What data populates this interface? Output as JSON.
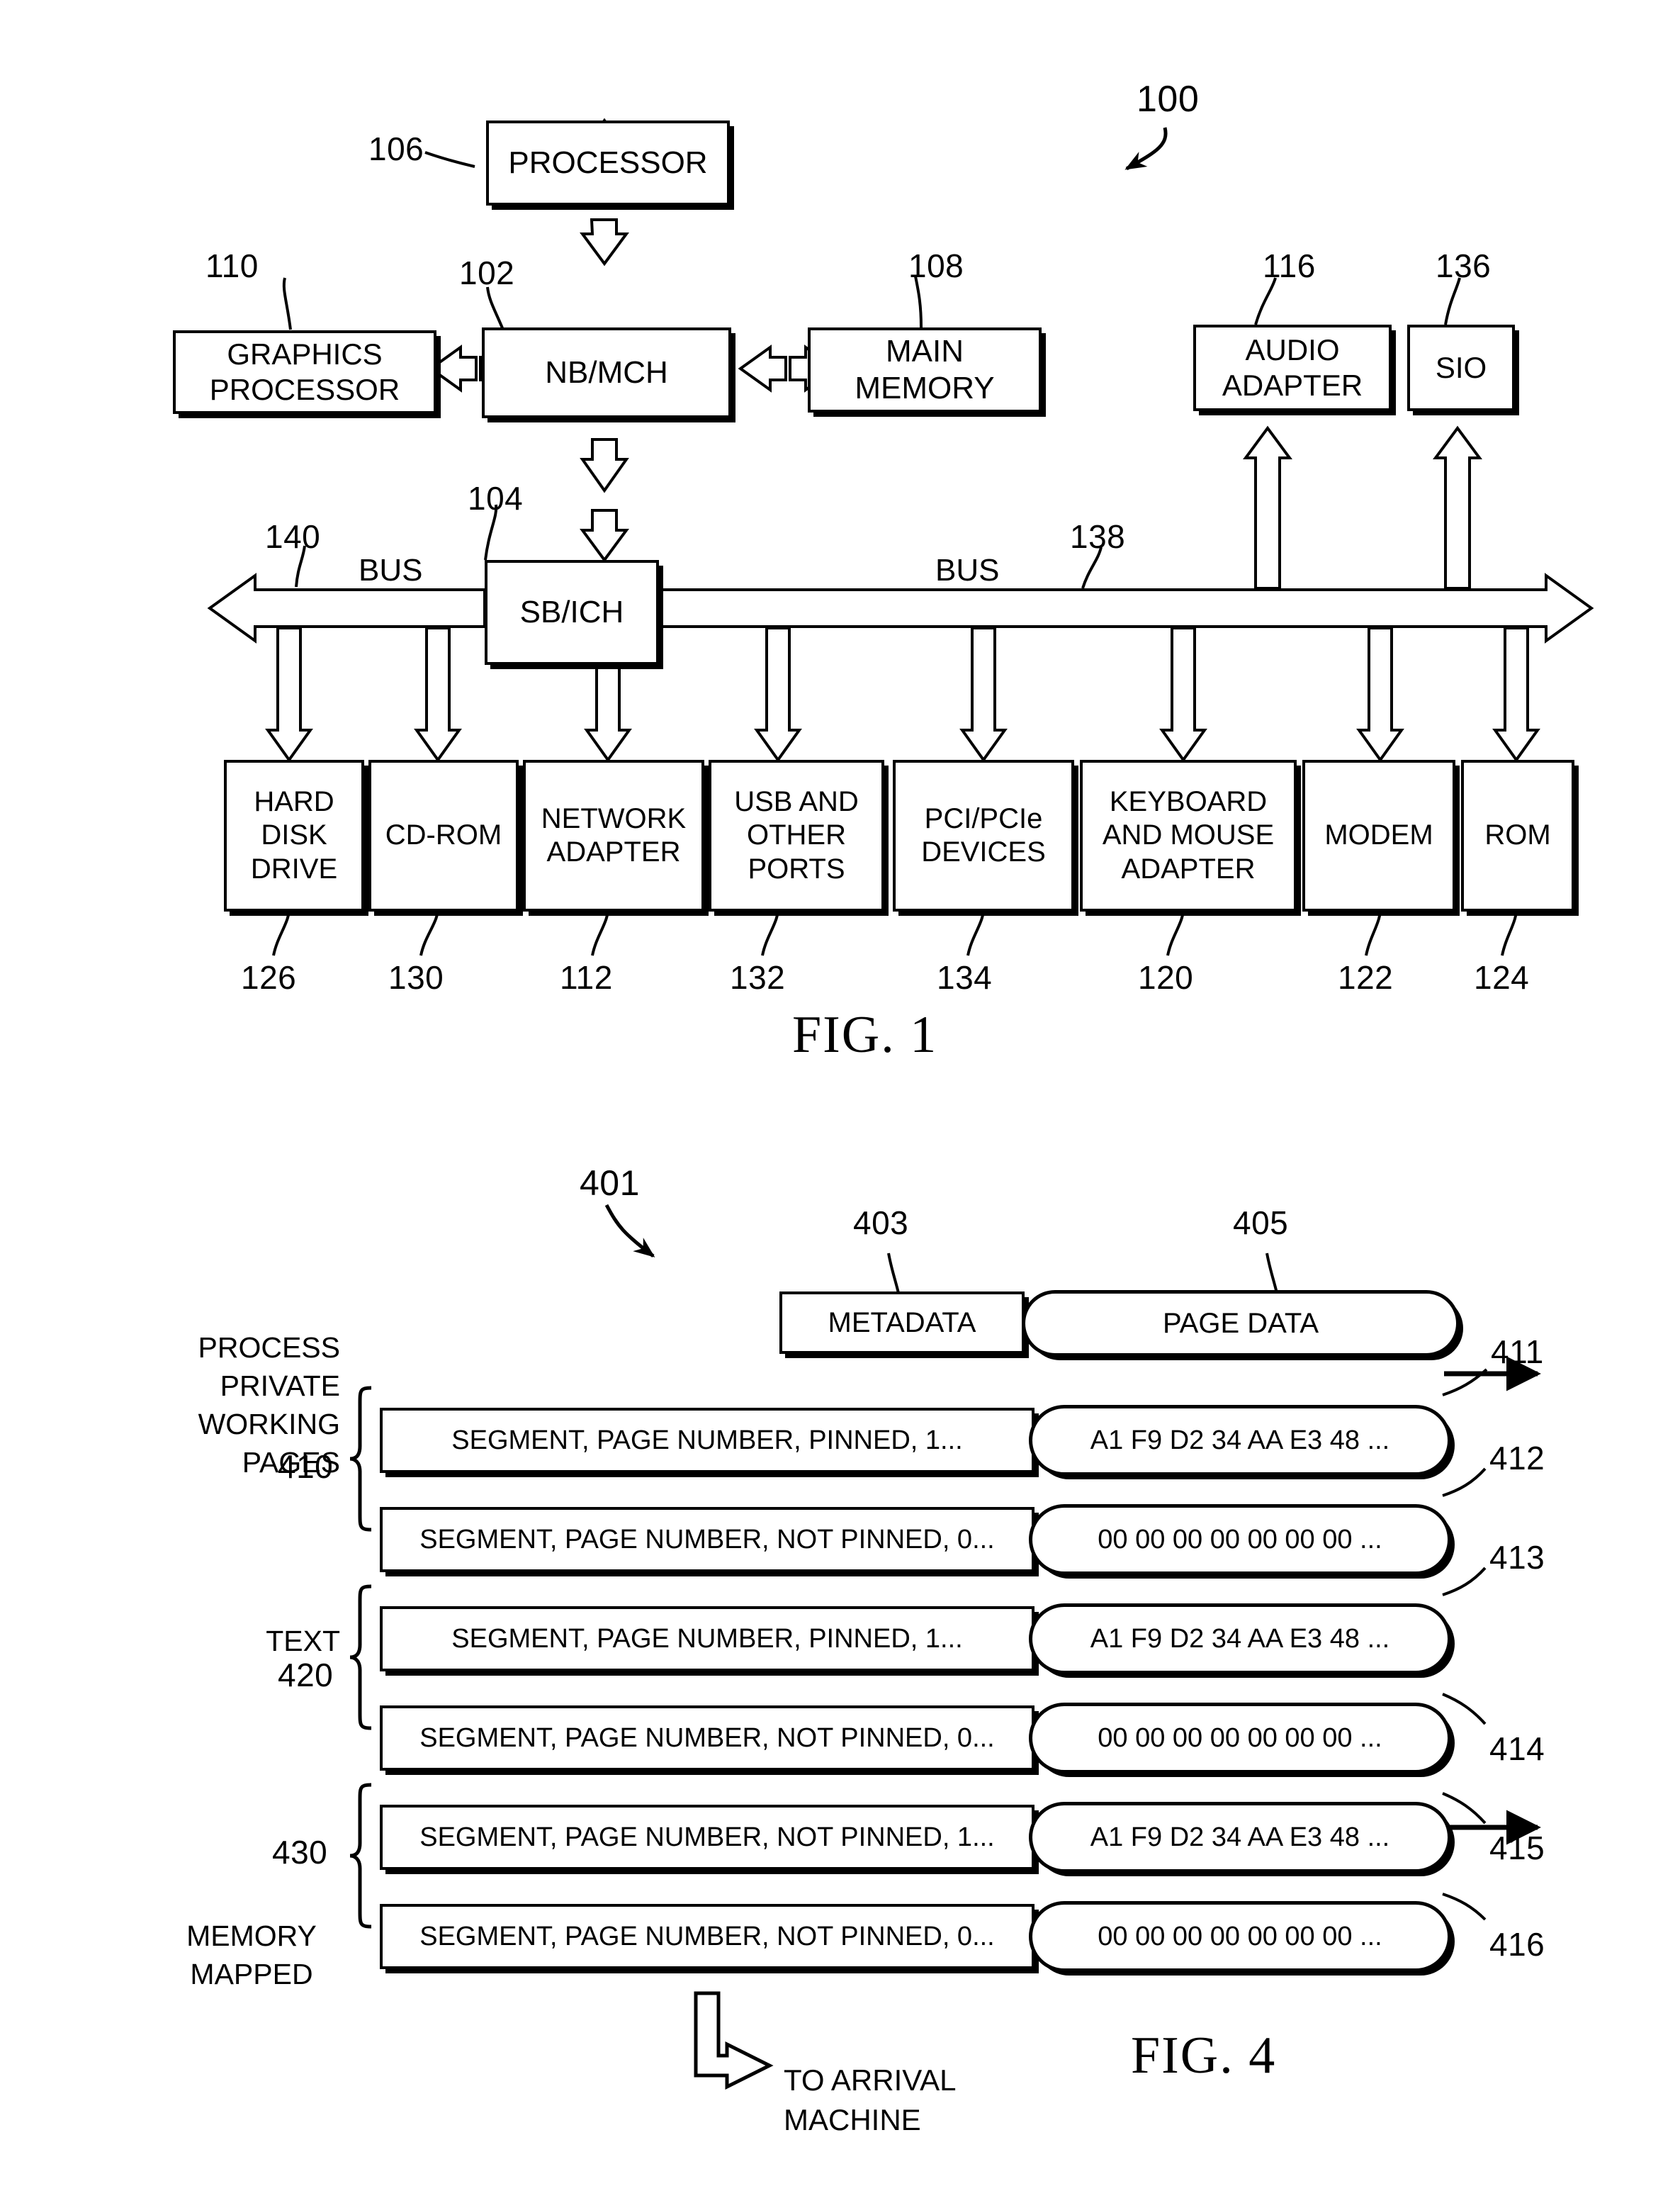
{
  "figure1": {
    "caption": "FIG. 1",
    "system_ref": "100",
    "blocks": [
      {
        "id": "processor",
        "label": "PROCESSOR",
        "ref": "106"
      },
      {
        "id": "graphics-processor",
        "label": "GRAPHICS\nPROCESSOR",
        "ref": "110"
      },
      {
        "id": "nb-mch",
        "label": "NB/MCH",
        "ref": "102"
      },
      {
        "id": "main-memory",
        "label": "MAIN\nMEMORY",
        "ref": "108"
      },
      {
        "id": "audio-adapter",
        "label": "AUDIO\nADAPTER",
        "ref": "116"
      },
      {
        "id": "sio",
        "label": "SIO",
        "ref": "136"
      },
      {
        "id": "sb-ich",
        "label": "SB/ICH",
        "ref": "104"
      }
    ],
    "bus_left": {
      "label": "BUS",
      "ref": "140"
    },
    "bus_right": {
      "label": "BUS",
      "ref": "138"
    },
    "devices": [
      {
        "id": "hard-disk-drive",
        "label": "HARD\nDISK\nDRIVE",
        "ref": "126"
      },
      {
        "id": "cd-rom",
        "label": "CD-ROM",
        "ref": "130"
      },
      {
        "id": "network-adapter",
        "label": "NETWORK\nADAPTER",
        "ref": "112"
      },
      {
        "id": "usb-and-other-ports",
        "label": "USB AND\nOTHER\nPORTS",
        "ref": "132"
      },
      {
        "id": "pci-pcie-devices",
        "label": "PCI/PCIe\nDEVICES",
        "ref": "134"
      },
      {
        "id": "keyboard-and-mouse-adapter",
        "label": "KEYBOARD\nAND MOUSE\nADAPTER",
        "ref": "120"
      },
      {
        "id": "modem",
        "label": "MODEM",
        "ref": "122"
      },
      {
        "id": "rom",
        "label": "ROM",
        "ref": "124"
      }
    ]
  },
  "figure4": {
    "caption": "FIG. 4",
    "diagram_ref": "401",
    "legend": [
      {
        "id": "metadata",
        "label": "METADATA",
        "ref": "403"
      },
      {
        "id": "page-data",
        "label": "PAGE DATA",
        "ref": "405"
      }
    ],
    "groups": [
      {
        "id": "process-private-working-pages",
        "label": "PROCESS\nPRIVATE\nWORKING\nPAGES",
        "ref": "410",
        "align": "right"
      },
      {
        "id": "text",
        "label": "TEXT",
        "ref": "420",
        "align": "right"
      },
      {
        "id": "memory-mapped",
        "label": "MEMORY\nMAPPED",
        "ref": "430",
        "align": "center"
      }
    ],
    "rows": [
      {
        "id": "row-411",
        "metadata": "SEGMENT, PAGE NUMBER, PINNED, 1...",
        "page_data": "A1 F9 D2 34 AA E3 48 ...",
        "ref": "411",
        "has_arrow": true
      },
      {
        "id": "row-412",
        "metadata": "SEGMENT, PAGE NUMBER, NOT PINNED, 0...",
        "page_data": "00 00 00 00 00 00 00 ...",
        "ref": "412",
        "has_arrow": false
      },
      {
        "id": "row-413",
        "metadata": "SEGMENT, PAGE NUMBER, PINNED, 1...",
        "page_data": "A1 F9 D2 34 AA E3 48 ...",
        "ref": "413",
        "has_arrow": false
      },
      {
        "id": "row-414",
        "metadata": "SEGMENT, PAGE NUMBER, NOT PINNED, 0...",
        "page_data": "00 00 00 00 00 00 00 ...",
        "ref": "414",
        "has_arrow": false
      },
      {
        "id": "row-415",
        "metadata": "SEGMENT, PAGE NUMBER, NOT PINNED, 1...",
        "page_data": "A1 F9 D2 34 AA E3 48 ...",
        "ref": "415",
        "has_arrow": true
      },
      {
        "id": "row-416",
        "metadata": "SEGMENT, PAGE NUMBER, NOT PINNED, 0...",
        "page_data": "00 00 00 00 00 00 00 ...",
        "ref": "416",
        "has_arrow": false
      }
    ],
    "arrival_note": "TO ARRIVAL\nMACHINE"
  }
}
